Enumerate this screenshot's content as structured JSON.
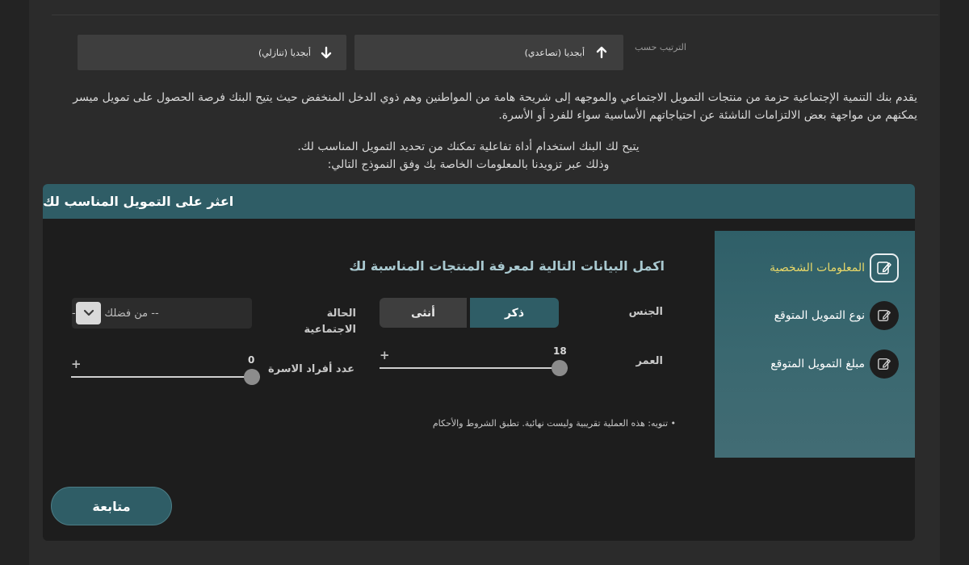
{
  "sort": {
    "label": "الترتيب حسب",
    "ascending_label": "أبجديا (تصاعدي)",
    "descending_label": "أبجديا (تنازلي)"
  },
  "intro": {
    "paragraph": "يقدم بنك التنمية الإجتماعية حزمة من منتجات التمويل الاجتماعي والموجهه إلى شريحة هامة من المواطنين وهم ذوي الدخل المنخفض حيث يتيح البنك فرصة الحصول على تمويل ميسر يمكنهم من مواجهة بعض الالتزامات الناشئة عن احتياجاتهم الأساسية سواء للفرد أو الأسرة.",
    "line1": "يتيح لك البنك استخدام أداة تفاعلية تمكنك من تحديد التمويل المناسب لك.",
    "line2": "وذلك عبر تزويدنا بالمعلومات الخاصة بك وفق النموذج التالي:"
  },
  "card": {
    "title": "اعثر على التمويل المناسب لك",
    "steps": [
      {
        "label": "المعلومات الشخصية",
        "icon": "edit-icon",
        "active": true
      },
      {
        "label": "نوع التمويل المتوقع",
        "icon": "edit-icon",
        "active": false
      },
      {
        "label": "مبلغ التمويل المتوقع",
        "icon": "edit-icon",
        "active": false
      }
    ],
    "form_title": "اكمل البيانات التالية لمعرفة المنتجات المناسبة لك",
    "gender": {
      "label": "الجنس",
      "male": "ذكر",
      "female": "أنثى",
      "selected": "ذكر"
    },
    "marital": {
      "label_line1": "الحالة",
      "label_line2": "الاجتماعية",
      "placeholder": "-- من فضلك اختر --"
    },
    "age": {
      "label": "العمر",
      "value": "18",
      "plus": "+"
    },
    "family": {
      "label": "عدد أفراد الاسرة",
      "value": "0",
      "plus": "+"
    },
    "note": "• تنويه: هذه العملية تقريبية وليست نهائية. تطبق الشروط والأحكام",
    "continue_label": "متابعة"
  },
  "colors": {
    "accent": "#2f5d66",
    "active_step": "#e9d868",
    "background": "#2b2b2b",
    "card": "#1d1d1d"
  }
}
